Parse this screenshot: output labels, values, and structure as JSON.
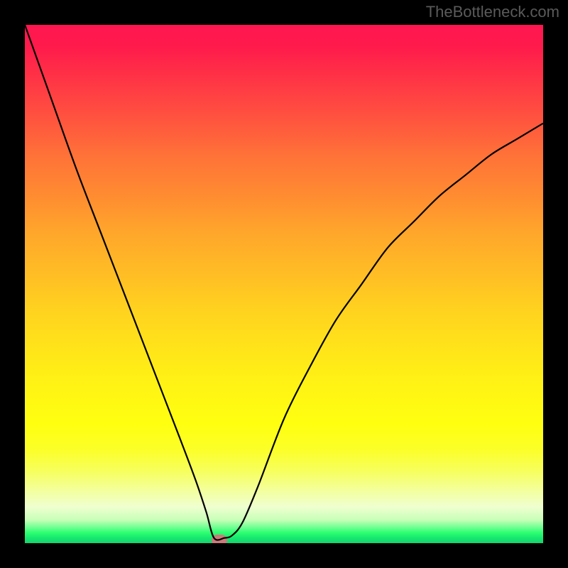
{
  "watermark": "TheBottleneck.com",
  "colors": {
    "frame": "#000000",
    "curve": "#000000",
    "marker": "#cc7a7a"
  },
  "chart_data": {
    "type": "line",
    "title": "",
    "xlabel": "",
    "ylabel": "",
    "xlim": [
      0,
      100
    ],
    "ylim": [
      0,
      100
    ],
    "note": "Bottleneck percentage curve. X is relative hardware balance position (0-100), Y is bottleneck percentage (0 = no bottleneck at green, 100 = severe at red). Values estimated from pixel positions.",
    "series": [
      {
        "name": "bottleneck-curve",
        "x": [
          0,
          5,
          10,
          15,
          20,
          25,
          30,
          33,
          35,
          36.5,
          38.5,
          40,
          42,
          45,
          50,
          55,
          60,
          65,
          70,
          75,
          80,
          85,
          90,
          95,
          100
        ],
        "values": [
          100,
          86,
          72,
          59,
          46,
          33,
          20,
          12,
          6,
          1,
          1,
          1.5,
          4,
          11,
          24,
          34,
          43,
          50,
          57,
          62,
          67,
          71,
          75,
          78,
          81
        ]
      }
    ],
    "marker": {
      "x": 37.5,
      "y": 0.5
    },
    "background_gradient": {
      "orientation": "vertical",
      "top_meaning": "high bottleneck (red)",
      "bottom_meaning": "no bottleneck (green)",
      "stops": [
        {
          "pct": 0,
          "color": "#ff1650"
        },
        {
          "pct": 50,
          "color": "#ffd21f"
        },
        {
          "pct": 80,
          "color": "#ffff10"
        },
        {
          "pct": 100,
          "color": "#16d46e"
        }
      ]
    }
  }
}
